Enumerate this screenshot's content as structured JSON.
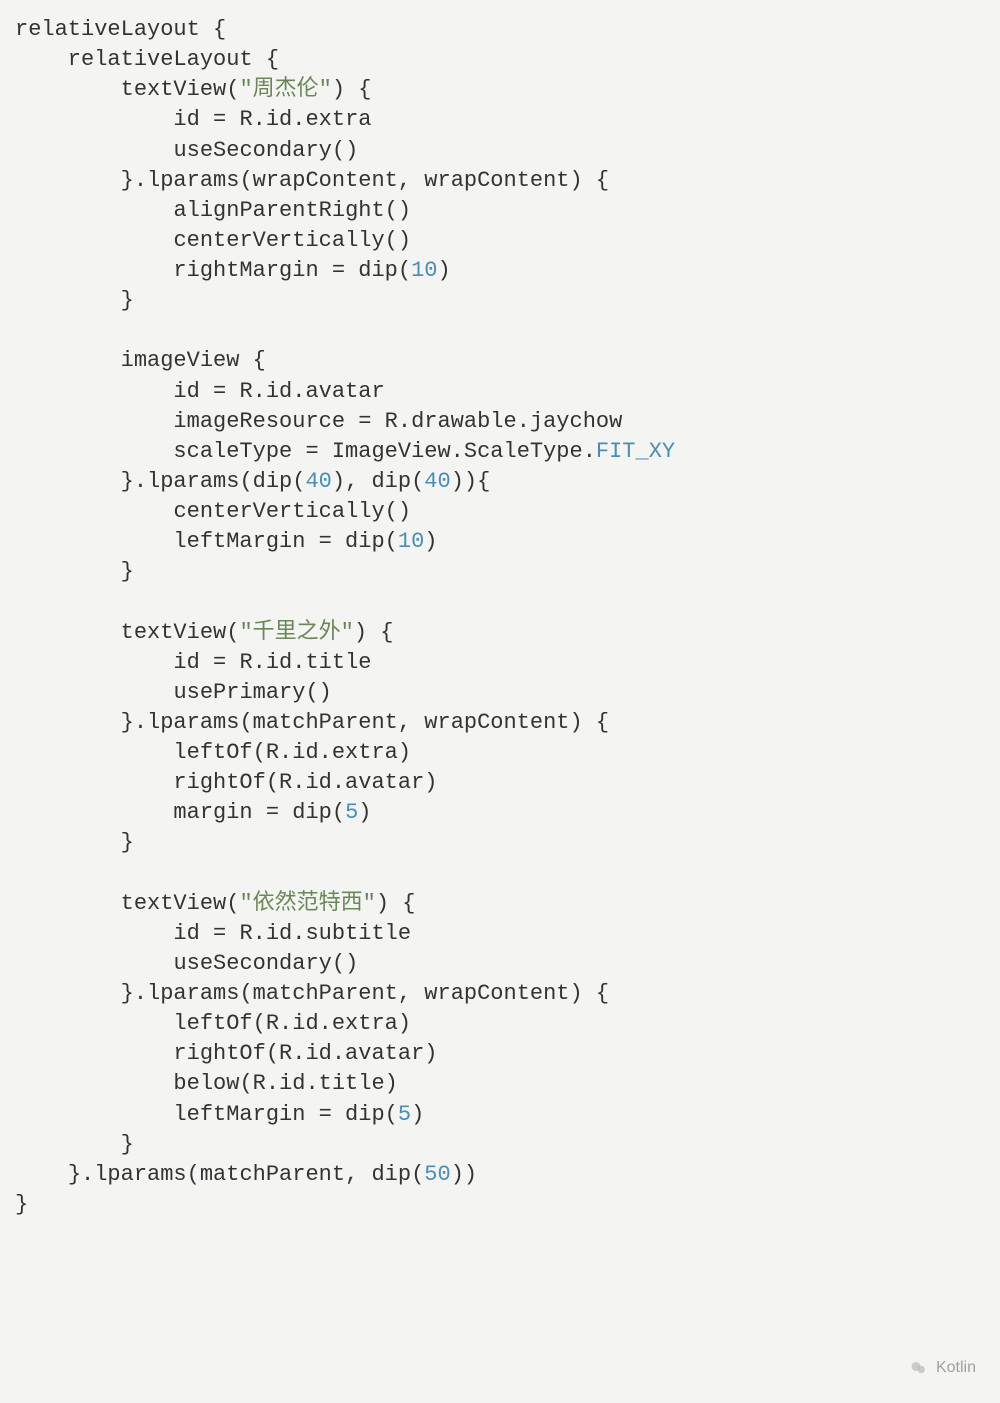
{
  "code": {
    "block1_textview_arg": "\"周杰伦\"",
    "block1_id": "R.id.extra",
    "block1_fn1": "useSecondary",
    "block1_lparams_args": "wrapContent, wrapContent",
    "block1_call1": "alignParentRight",
    "block1_call2": "centerVertically",
    "block1_num": "10",
    "block2_id": "R.id.avatar",
    "block2_res": "R.drawable.jaychow",
    "block2_scale": "ImageView.ScaleType.",
    "block2_scale_const": "FIT_XY",
    "block2_dip_a": "40",
    "block2_dip_b": "40",
    "block2_call1": "centerVertically",
    "block2_num": "10",
    "block3_textview_arg": "\"千里之外\"",
    "block3_id": "R.id.title",
    "block3_fn1": "usePrimary",
    "block3_lparams_args": "matchParent, wrapContent",
    "block3_leftof": "R.id.extra",
    "block3_rightof": "R.id.avatar",
    "block3_num": "5",
    "block4_textview_arg": "\"依然范特西\"",
    "block4_id": "R.id.subtitle",
    "block4_fn1": "useSecondary",
    "block4_lparams_args": "matchParent, wrapContent",
    "block4_leftof": "R.id.extra",
    "block4_rightof": "R.id.avatar",
    "block4_below": "R.id.title",
    "block4_num": "5",
    "outer_lparams_arg1": "matchParent",
    "outer_dip": "50"
  },
  "watermark": "Kotlin"
}
